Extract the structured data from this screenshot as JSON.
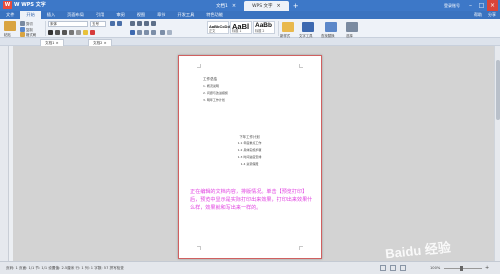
{
  "app": {
    "logo": "W WPS 文字",
    "logo_letter": "W"
  },
  "tabs": [
    {
      "label": "文档1",
      "active": false
    },
    {
      "label": "WPS 文字",
      "active": true
    }
  ],
  "window": {
    "user": "登录账号"
  },
  "menu": [
    "文件",
    "开始",
    "插入",
    "页面布局",
    "引用",
    "审阅",
    "视图",
    "章节",
    "开发工具",
    "特色功能"
  ],
  "menu_active": "开始",
  "menu_right": [
    "帮助",
    "分享"
  ],
  "ribbon": {
    "paste": "粘贴",
    "cut": "剪切",
    "copy": "复制",
    "format": "格式刷",
    "font_name": "宋体",
    "font_size": "五号",
    "styles": [
      {
        "sample": "AaBbCcDd",
        "name": "正文"
      },
      {
        "sample": "AaBl",
        "name": "标题 1"
      },
      {
        "sample": "AaBb",
        "name": "标题 2"
      }
    ],
    "new_style": "新样式",
    "text_tools": "文字工具",
    "find_replace": "查找替换",
    "select": "选择"
  },
  "doc_tabs": [
    {
      "label": "文档1 ×"
    },
    {
      "label": "文档2 ×"
    }
  ],
  "document": {
    "toc_title": "工作总结",
    "toc_items": [
      "1. 概况说明",
      "2. 问题与改进措施",
      "3. 明年工作计划"
    ],
    "section_title": "下年工作计划",
    "section_items": [
      "1.1 年度重点工作",
      "1.2 具体实施步骤",
      "1.3 时间进度安排",
      "1.4 资源保障"
    ],
    "annotation": "正在编辑的文档内容，排版情况。单击【预览打印】后，预览中显示是实际打印出来效果，打印出来效果什么样，效果就和写出来一样的。"
  },
  "watermark": "Baidu 经验",
  "status": {
    "text": "页码: 1  页面: 1/1  节: 1/1  设置值: 2.5厘米  行: 1  列: 1  字数: 57  拼写检查",
    "zoom": "100%"
  }
}
